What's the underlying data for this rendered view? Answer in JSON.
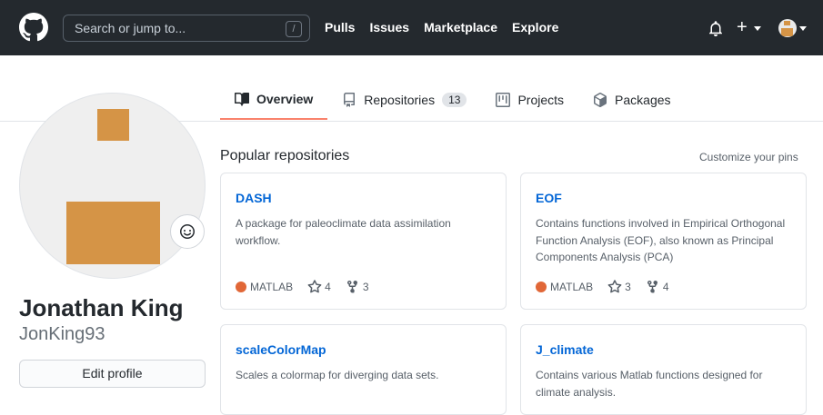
{
  "header": {
    "search_placeholder": "Search or jump to...",
    "slash_key": "/",
    "nav": [
      "Pulls",
      "Issues",
      "Marketplace",
      "Explore"
    ],
    "plus_label": "+"
  },
  "tabs": [
    {
      "label": "Overview",
      "icon": "book-icon",
      "active": true
    },
    {
      "label": "Repositories",
      "icon": "repo-icon",
      "count": "13"
    },
    {
      "label": "Projects",
      "icon": "project-icon"
    },
    {
      "label": "Packages",
      "icon": "package-icon"
    }
  ],
  "profile": {
    "full_name": "Jonathan King",
    "username": "JonKing93",
    "edit_label": "Edit profile"
  },
  "popular": {
    "title": "Popular repositories",
    "customize_label": "Customize your pins",
    "repos": [
      {
        "name": "DASH",
        "description": "A package for paleoclimate data assimilation workflow.",
        "language": "MATLAB",
        "stars": "4",
        "forks": "3"
      },
      {
        "name": "EOF",
        "description": "Contains functions involved in Empirical Orthogonal Function Analysis (EOF), also known as Principal Components Analysis (PCA)",
        "language": "MATLAB",
        "stars": "3",
        "forks": "4"
      },
      {
        "name": "scaleColorMap",
        "description": "Scales a colormap for diverging data sets."
      },
      {
        "name": "J_climate",
        "description": "Contains various Matlab functions designed for climate analysis."
      }
    ]
  },
  "colors": {
    "header_bg": "#24292e",
    "link": "#0366d6",
    "tab_accent": "#f9826c",
    "matlab": "#e16737",
    "avatar_block": "#d59446"
  }
}
